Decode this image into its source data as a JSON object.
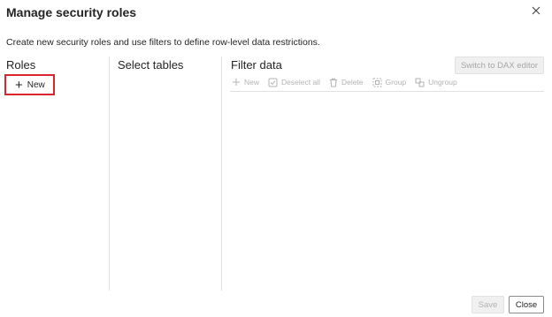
{
  "dialog": {
    "title": "Manage security roles",
    "subtitle": "Create new security roles and use filters to define row-level data restrictions."
  },
  "roles": {
    "heading": "Roles",
    "new_label": "New"
  },
  "tables": {
    "heading": "Select tables"
  },
  "filter": {
    "heading": "Filter data",
    "dax_button": "Switch to DAX editor",
    "toolbar": {
      "new_label": "New",
      "deselect_label": "Deselect all",
      "delete_label": "Delete",
      "group_label": "Group",
      "ungroup_label": "Ungroup"
    }
  },
  "footer": {
    "save_label": "Save",
    "close_label": "Close"
  },
  "colors": {
    "highlight": "#d9262c",
    "disabled_text": "#b3b3b3"
  }
}
